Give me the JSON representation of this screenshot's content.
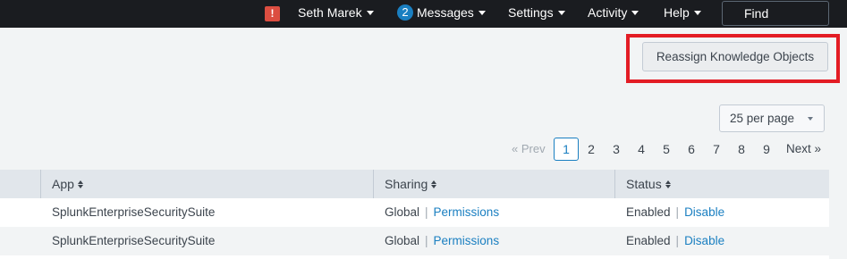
{
  "topbar": {
    "alert_icon": "!",
    "user_label": "Seth Marek",
    "messages_count": "2",
    "messages_label": "Messages",
    "settings_label": "Settings",
    "activity_label": "Activity",
    "help_label": "Help",
    "find_placeholder": "Find"
  },
  "actions": {
    "reassign_label": "Reassign Knowledge Objects"
  },
  "pagination": {
    "per_page_label": "25 per page",
    "prev_label": "« Prev",
    "current_page": "1",
    "pages": [
      "2",
      "3",
      "4",
      "5",
      "6",
      "7",
      "8",
      "9"
    ],
    "next_label": "Next »"
  },
  "table": {
    "headers": {
      "app": "App",
      "sharing": "Sharing",
      "status": "Status"
    },
    "rows": [
      {
        "app": "SplunkEnterpriseSecuritySuite",
        "sharing": "Global",
        "sharing_action": "Permissions",
        "status": "Enabled",
        "status_action": "Disable"
      },
      {
        "app": "SplunkEnterpriseSecuritySuite",
        "sharing": "Global",
        "sharing_action": "Permissions",
        "status": "Enabled",
        "status_action": "Disable"
      }
    ]
  },
  "colors": {
    "topbar_bg": "#1a1c20",
    "link": "#1a7fc1",
    "alert": "#dc4e41",
    "highlight": "#e31c24"
  }
}
